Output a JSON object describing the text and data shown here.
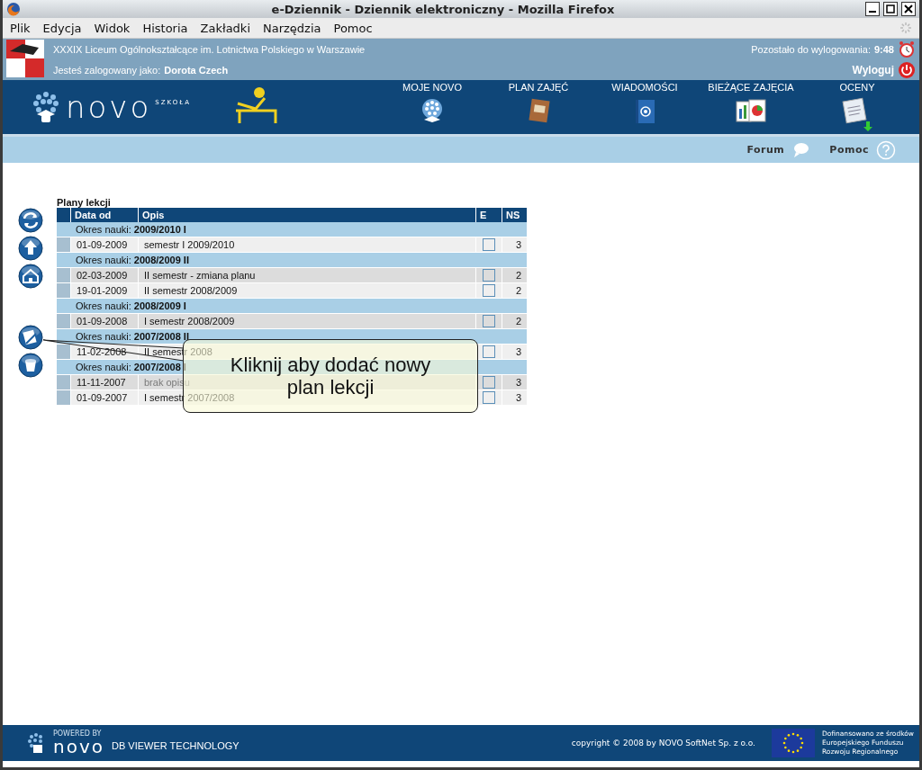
{
  "window": {
    "title": "e-Dziennik - Dziennik elektroniczny - Mozilla Firefox"
  },
  "menu": [
    {
      "label": "Plik"
    },
    {
      "label": "Edycja"
    },
    {
      "label": "Widok"
    },
    {
      "label": "Historia"
    },
    {
      "label": "Zakładki"
    },
    {
      "label": "Narzędzia"
    },
    {
      "label": "Pomoc"
    }
  ],
  "header": {
    "school": "XXXIX Liceum Ogólnokształcące im. Lotnictwa Polskiego w Warszawie",
    "user_label": "Jesteś zalogowany jako:",
    "user": "Dorota Czech",
    "timeout_label": "Pozostało do wylogowania:",
    "timeout": "9:48",
    "logout": "Wyloguj"
  },
  "brand": {
    "name": "novo",
    "sub": "SZKOŁA"
  },
  "nav": [
    {
      "label": "MOJE NOVO",
      "kind": "globe"
    },
    {
      "label": "PLAN ZAJĘĆ",
      "kind": "book"
    },
    {
      "label": "WIADOMOŚCI",
      "kind": "mail"
    },
    {
      "label": "BIEŻĄCE ZAJĘCIA",
      "kind": "charts"
    },
    {
      "label": "OCENY",
      "kind": "docs"
    }
  ],
  "subnav": [
    {
      "label": "Forum",
      "kind": "chat"
    },
    {
      "label": "Pomoc",
      "kind": "help"
    }
  ],
  "actions": [
    {
      "kind": "refresh"
    },
    {
      "kind": "up"
    },
    {
      "kind": "home"
    }
  ],
  "edit_actions": [
    {
      "kind": "edit"
    },
    {
      "kind": "delete"
    }
  ],
  "table": {
    "title": "Plany lekcji",
    "columns": [
      "Data od",
      "Opis",
      "E",
      "NS"
    ],
    "rows": [
      {
        "kind": "group",
        "label": "Okres nauki:",
        "value": "2009/2010 I"
      },
      {
        "kind": "plan",
        "date": "01-09-2009",
        "description": "semestr I 2009/2010",
        "muted": false,
        "checked": false,
        "ns": "3"
      },
      {
        "kind": "group",
        "label": "Okres nauki:",
        "value": "2008/2009 II"
      },
      {
        "kind": "plan",
        "date": "02-03-2009",
        "description": "II semestr - zmiana planu",
        "muted": false,
        "checked": false,
        "ns": "2"
      },
      {
        "kind": "plan",
        "date": "19-01-2009",
        "description": "II semestr 2008/2009",
        "muted": false,
        "checked": false,
        "ns": "2"
      },
      {
        "kind": "group",
        "label": "Okres nauki:",
        "value": "2008/2009 I"
      },
      {
        "kind": "plan",
        "date": "01-09-2008",
        "description": "I semestr 2008/2009",
        "muted": false,
        "checked": false,
        "ns": "2"
      },
      {
        "kind": "group",
        "label": "Okres nauki:",
        "value": "2007/2008 II"
      },
      {
        "kind": "plan",
        "date": "11-02-2008",
        "description": "II semestr 2008",
        "muted": false,
        "checked": false,
        "ns": "3"
      },
      {
        "kind": "group",
        "label": "Okres nauki:",
        "value": "2007/2008 I"
      },
      {
        "kind": "plan",
        "date": "11-11-2007",
        "description": "brak opisu",
        "muted": true,
        "checked": false,
        "ns": "3"
      },
      {
        "kind": "plan",
        "date": "01-09-2007",
        "description": "I semestr 2007/2008",
        "muted": false,
        "checked": false,
        "ns": "3"
      }
    ]
  },
  "tooltip": {
    "text": "Kliknij aby dodać nowy plan lekcji"
  },
  "footer": {
    "powered": "POWERED BY",
    "brand": "novo",
    "tech": "DB VIEWER TECHNOLOGY",
    "copyright": "copyright © 2008 by NOVO SoftNet Sp. z o.o.",
    "eu": [
      "Dofinansowano ze środków",
      "Europejskiego Funduszu",
      "Rozwoju Regionalnego"
    ]
  }
}
